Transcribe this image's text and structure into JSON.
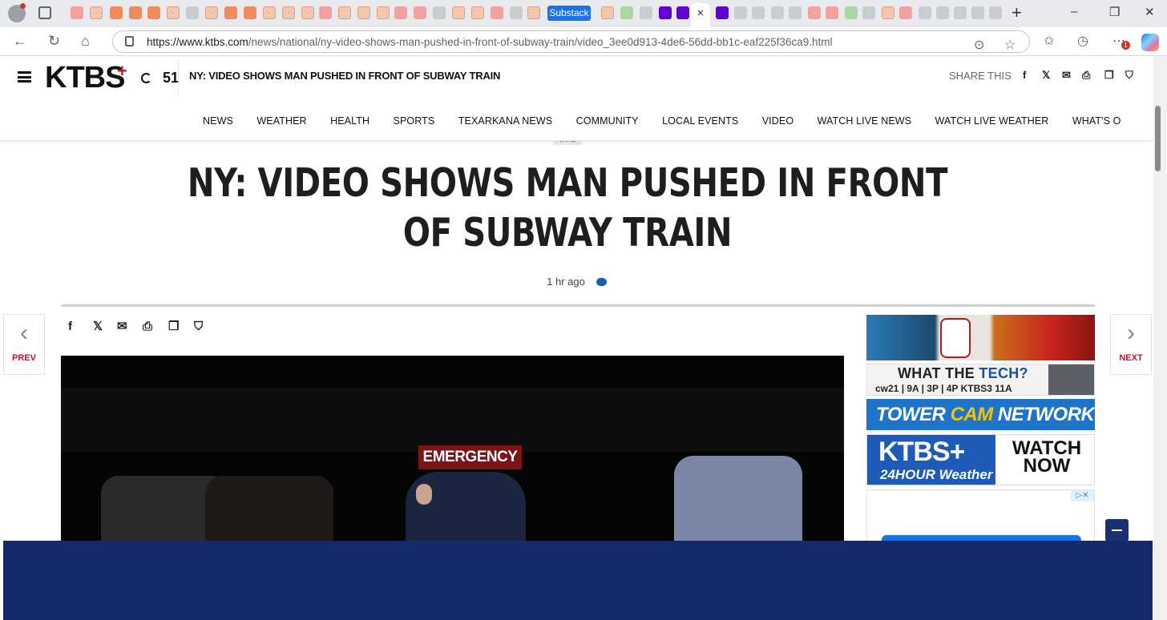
{
  "browser": {
    "substack_tab": "Substack",
    "active_tab_close": "×",
    "new_tab": "+",
    "url_domain": "https://www.ktbs.com",
    "url_path": "/news/national/ny-video-shows-man-pushed-in-front-of-subway-train/video_3ee0d913-4de6-56dd-bb1c-eaf225f36ca9.html",
    "notification_count": "1",
    "window_controls": [
      "–",
      "❐",
      "✕"
    ]
  },
  "site": {
    "logo": "KTBS",
    "logo_plus": "+",
    "temperature": "51",
    "header_title": "NY: VIDEO SHOWS MAN PUSHED IN FRONT OF SUBWAY TRAIN",
    "share_label": "SHARE THIS",
    "nav": [
      "NEWS",
      "WEATHER",
      "HEALTH",
      "SPORTS",
      "TEXARKANA NEWS",
      "COMMUNITY",
      "LOCAL EVENTS",
      "VIDEO",
      "WATCH LIVE NEWS",
      "WATCH LIVE WEATHER",
      "WHAT'S O"
    ]
  },
  "article": {
    "tag": "WIRE",
    "headline": "NY: VIDEO SHOWS MAN PUSHED IN FRONT OF SUBWAY TRAIN",
    "time": "1 hr ago",
    "prev_label": "PREV",
    "next_label": "NEXT",
    "video_sign": "EMERGENCY"
  },
  "ads": {
    "ad2_title_a": "WHAT THE ",
    "ad2_title_b": "TECH?",
    "ad2_schedule": "cw21 | 9A | 3P | 4P    KTBS3 11A",
    "ad3_a": "TOWER ",
    "ad3_b": "CAM",
    "ad3_c": " NETWORK",
    "ad4_ktbs": "KTBS+",
    "ad4_weather": "24HOUR Weather",
    "ad4_watch": "WATCH NOW",
    "adchoices": "▷✕"
  },
  "colors": {
    "brand_red": "#d71920",
    "link_blue": "#1a5fb4",
    "banner_navy": "#142a6b"
  }
}
